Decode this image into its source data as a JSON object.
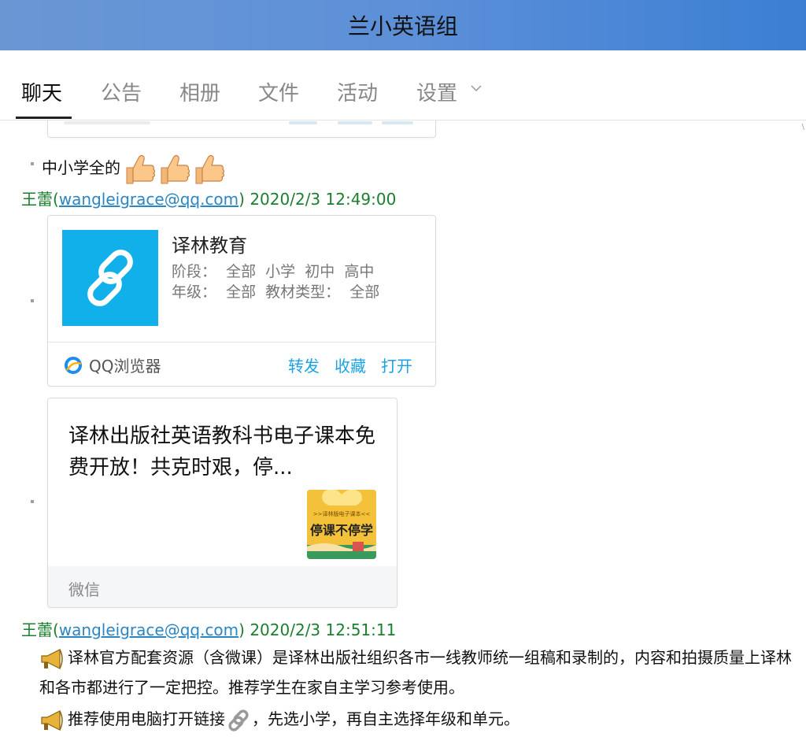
{
  "window": {
    "title": "兰小英语组"
  },
  "tabs": [
    {
      "label": "聊天",
      "active": true
    },
    {
      "label": "公告"
    },
    {
      "label": "相册"
    },
    {
      "label": "文件"
    },
    {
      "label": "活动"
    },
    {
      "label": "设置"
    }
  ],
  "messages": {
    "m1": {
      "text": "中小学全的"
    },
    "m2": {
      "name": "王蕾",
      "email": "wangleigrace@qq.com",
      "time": "2020/2/3 12:49:00",
      "link_card": {
        "title": "译林教育",
        "desc_line1": "阶段：  全部  小学  初中  高中",
        "desc_line2": "年级：  全部  教材类型：  全部",
        "source": "QQ浏览器",
        "actions": [
          "转发",
          "收藏",
          "打开"
        ]
      },
      "article_card": {
        "title": "译林出版社英语教科书电子课本免费开放！共克时艰，停...",
        "thumb_caption": ">>译林版电子课本<<",
        "thumb_text": "停课不停学",
        "source": "微信"
      }
    },
    "m3": {
      "name": "王蕾",
      "email": "wangleigrace@qq.com",
      "time": "2020/2/3 12:51:11",
      "para1": "译林官方配套资源（含微课）是译林出版社组织各市一线教师统一组稿和录制的，内容和拍摄质量上译林和各市都进行了一定把控。推荐学生在家自主学习参考使用。",
      "para2_a": "推荐使用电脑打开链接",
      "para2_b": "，先选小学，再自主选择年级和单元。"
    }
  },
  "colors": {
    "titlebar_start": "#6a97d4",
    "titlebar_end": "#3b7fd3",
    "sender_green": "#1a7f2e",
    "email_blue": "#2b86c4",
    "action_blue": "#1aa2e6",
    "link_thumb_bg": "#12b0ea"
  },
  "icons": [
    "thumbs-up-icon",
    "chain-link-icon",
    "qq-browser-icon",
    "chevron-down-icon",
    "horn-icon"
  ]
}
